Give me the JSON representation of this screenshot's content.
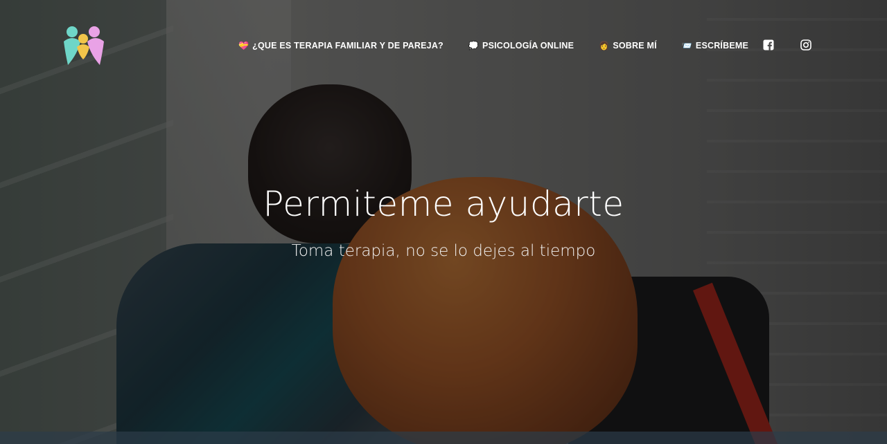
{
  "nav": {
    "items": [
      {
        "icon": "💝",
        "label": "¿QUE ES TERAPIA FAMILIAR Y DE PAREJA?"
      },
      {
        "icon": "💭",
        "label": "PSICOLOGÍA ONLINE"
      },
      {
        "icon": "👩",
        "label": "SOBRE MÍ"
      },
      {
        "icon": "📨",
        "label": "ESCRÍBEME"
      }
    ],
    "social": [
      "facebook-icon",
      "instagram-icon"
    ]
  },
  "hero": {
    "title": "Permiteme ayudarte",
    "subtitle": "Toma terapia, no se lo dejes al tiempo"
  },
  "colors": {
    "logo_teal": "#6fd6c8",
    "logo_yellow": "#f2c54a",
    "logo_pink": "#e9a2e6",
    "text": "#ffffff"
  }
}
